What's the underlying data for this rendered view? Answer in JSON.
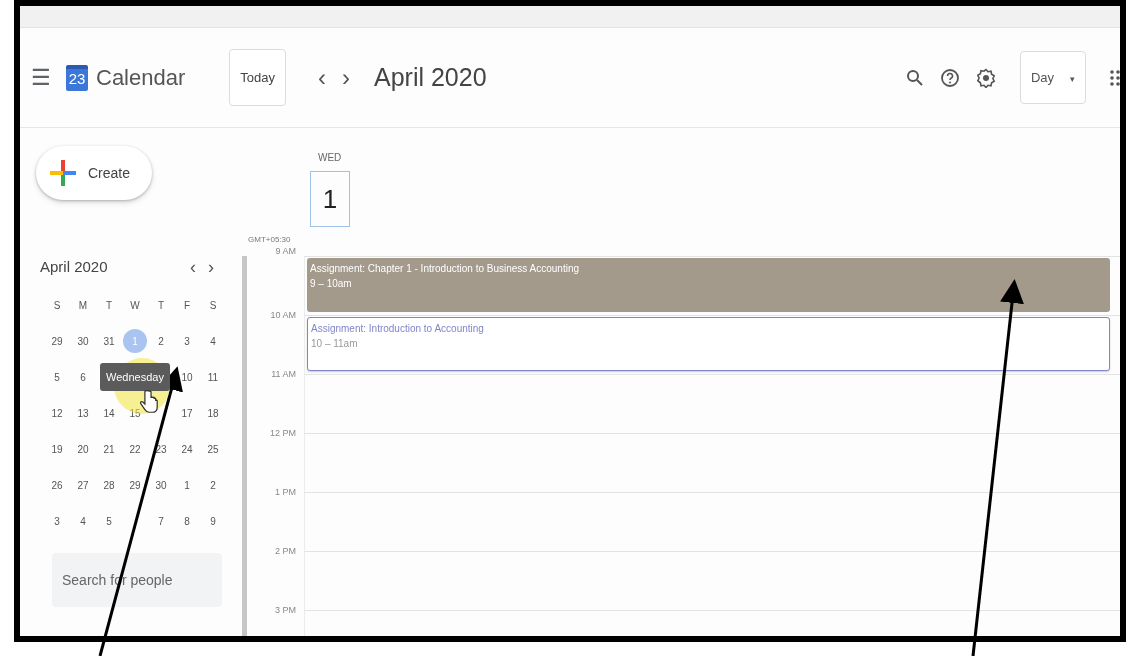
{
  "header": {
    "menu_icon": "☰",
    "logo_day": "23",
    "app_name": "Calendar",
    "today_button": "Today",
    "prev": "‹",
    "next": "›",
    "period": "April 2020",
    "view_button": "Day",
    "view_caret": "▾"
  },
  "sidebar": {
    "create_button": "Create",
    "mini_calendar": {
      "title": "April 2020",
      "prev": "‹",
      "next": "›",
      "weekdays": [
        "S",
        "M",
        "T",
        "W",
        "T",
        "F",
        "S"
      ],
      "weeks": [
        [
          {
            "day": "29",
            "selected": false
          },
          {
            "day": "30",
            "selected": false
          },
          {
            "day": "31",
            "selected": false
          },
          {
            "day": "1",
            "selected": true
          },
          {
            "day": "2",
            "selected": false
          },
          {
            "day": "3",
            "selected": false
          },
          {
            "day": "4",
            "selected": false
          }
        ],
        [
          {
            "day": "5",
            "selected": false
          },
          {
            "day": "6",
            "selected": false
          },
          {
            "kind": "tooltip",
            "text": "Wednesday"
          },
          {
            "day": "10",
            "selected": false
          },
          {
            "day": "11",
            "selected": false
          }
        ],
        [
          {
            "day": "12",
            "selected": false
          },
          {
            "day": "13",
            "selected": false
          },
          {
            "day": "14",
            "selected": false
          },
          {
            "day": "15",
            "selected": false
          },
          {
            "kind": "blank"
          },
          {
            "day": "17",
            "selected": false
          },
          {
            "day": "18",
            "selected": false
          }
        ],
        [
          {
            "day": "19",
            "selected": false
          },
          {
            "day": "20",
            "selected": false
          },
          {
            "day": "21",
            "selected": false
          },
          {
            "day": "22",
            "selected": false
          },
          {
            "day": "23",
            "selected": false
          },
          {
            "day": "24",
            "selected": false
          },
          {
            "day": "25",
            "selected": false
          }
        ],
        [
          {
            "day": "26",
            "selected": false
          },
          {
            "day": "27",
            "selected": false
          },
          {
            "day": "28",
            "selected": false
          },
          {
            "day": "29",
            "selected": false
          },
          {
            "day": "30",
            "selected": false
          },
          {
            "day": "1",
            "selected": false
          },
          {
            "day": "2",
            "selected": false
          }
        ],
        [
          {
            "day": "3",
            "selected": false
          },
          {
            "day": "4",
            "selected": false
          },
          {
            "day": "5",
            "selected": false
          },
          {
            "kind": "blank"
          },
          {
            "day": "7",
            "selected": false
          },
          {
            "day": "8",
            "selected": false
          },
          {
            "day": "9",
            "selected": false
          }
        ]
      ]
    },
    "search": {
      "placeholder": "Search for people"
    }
  },
  "day_view": {
    "weekday": "WED",
    "date": "1",
    "timezone": "GMT+05:30",
    "hours": [
      {
        "label": "9 AM",
        "event": {
          "title": "Assignment: Chapter 1 - Introduction to Business Accounting",
          "time": "9 – 10am",
          "color": "#a39a8c",
          "kind": "filled"
        }
      },
      {
        "label": "10 AM",
        "event": {
          "title": "Assignment: Introduction to Accounting",
          "time": "10 – 11am",
          "color": "#7f86c9",
          "kind": "outlined"
        }
      },
      {
        "label": "11 AM"
      },
      {
        "label": "12 PM"
      },
      {
        "label": "1 PM"
      },
      {
        "label": "2 PM"
      },
      {
        "label": "3 PM"
      }
    ]
  }
}
